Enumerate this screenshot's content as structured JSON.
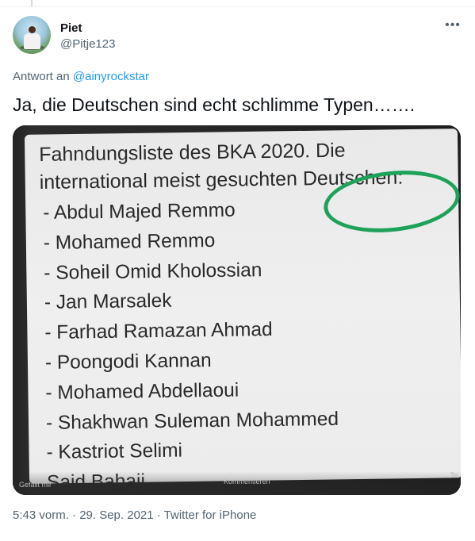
{
  "tweet": {
    "author": {
      "name": "Piet",
      "handle": "@Pitje123"
    },
    "reply_prefix": "Antwort an",
    "reply_to": "@ainyrockstar",
    "text": "Ja, die Deutschen sind echt schlimme Typen…….",
    "timestamp": "5:43 vorm. · 29. Sep. 2021 · Twitter for iPhone",
    "more_icon": "more-horizontal-icon"
  },
  "media": {
    "title_line1": "Fahndungsliste des BKA 2020. Die",
    "title_line2": "international meist gesuchten Deutschen:",
    "names": [
      "- Abdul Majed Remmo",
      "- Mohamed Remmo",
      "- Soheil Omid Kholossian",
      "- Jan Marsalek",
      "- Farhad Ramazan Ahmad",
      "- Poongodi Kannan",
      "- Mohamed Abdellaoui",
      "- Shakhwan Suleman Mohammed",
      "- Kastriot Selimi",
      "Said Bahaii"
    ],
    "overlay": {
      "like": "Gefällt mir",
      "comment": "Kommentieren",
      "share": "Te"
    },
    "highlight_color": "#1ea25a"
  },
  "colors": {
    "accent": "#1d9bf0",
    "muted": "#536471",
    "text": "#0f1419"
  }
}
